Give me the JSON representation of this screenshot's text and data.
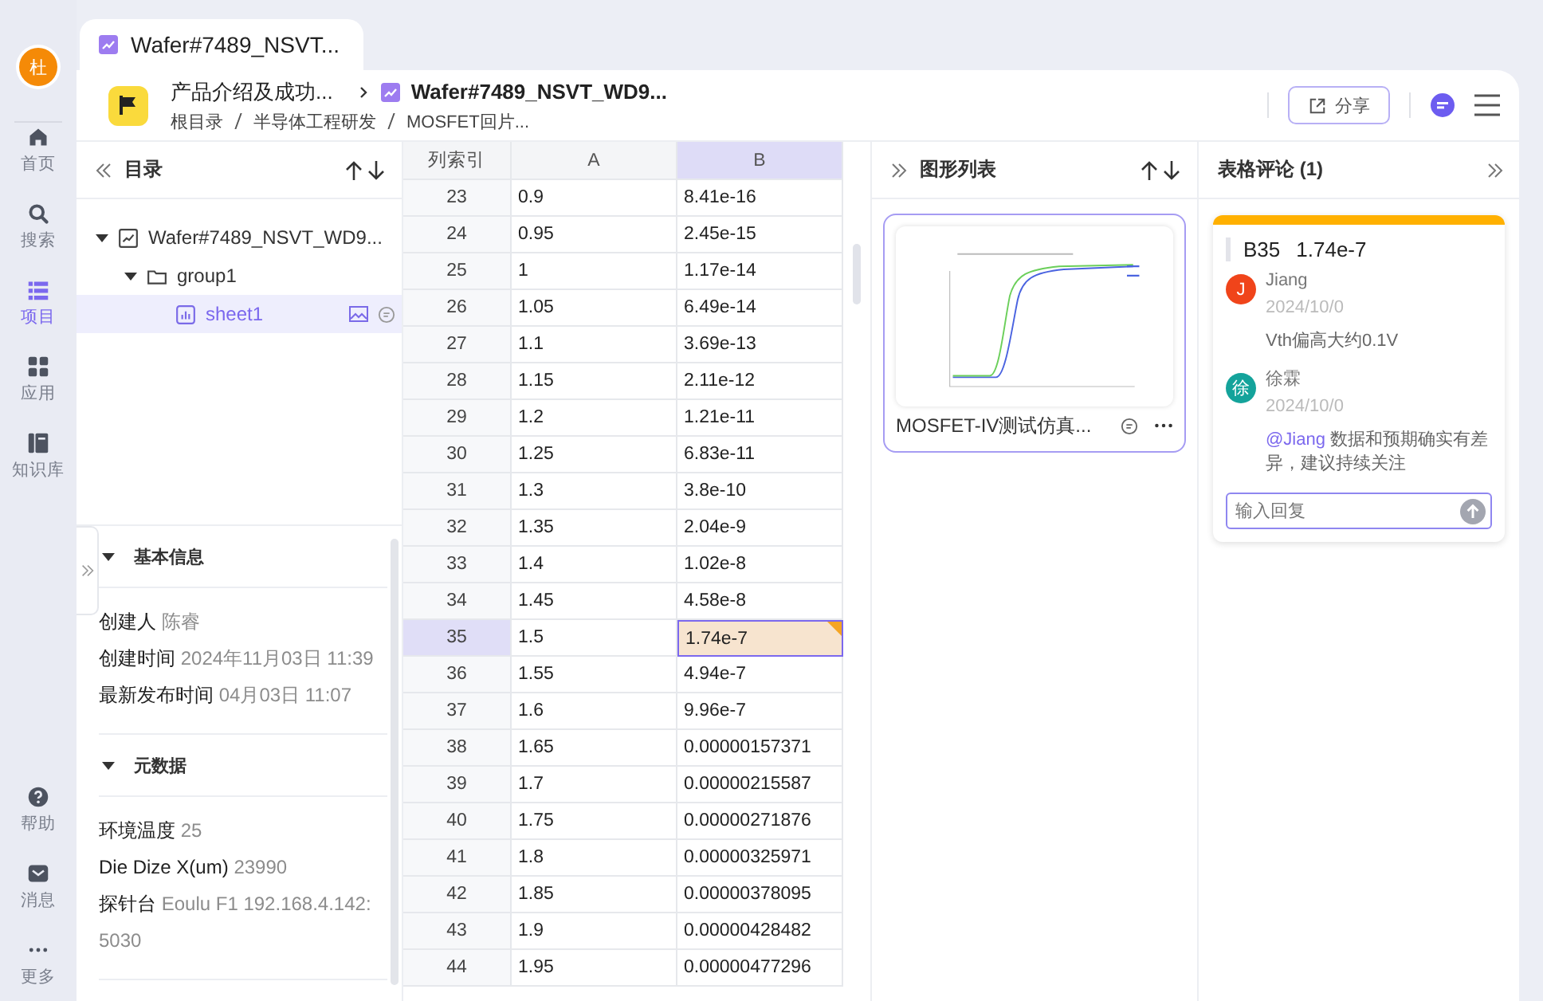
{
  "rail": {
    "avatar": "杜",
    "items": [
      {
        "label": "首页",
        "selected": false
      },
      {
        "label": "搜索",
        "selected": false
      },
      {
        "label": "项目",
        "selected": true
      },
      {
        "label": "应用",
        "selected": false
      },
      {
        "label": "知识库",
        "selected": false
      }
    ],
    "bottom_items": [
      {
        "label": "帮助",
        "selected": false
      },
      {
        "label": "消息",
        "selected": false
      },
      {
        "label": "更多",
        "selected": false
      }
    ]
  },
  "tab": {
    "title": "Wafer#7489_NSVT..."
  },
  "header": {
    "project": "产品介绍及成功...",
    "document": "Wafer#7489_NSVT_WD9...",
    "breadcrumb": [
      "根目录",
      "半导体工程研发",
      "MOSFET回片..."
    ],
    "share_button": "分享"
  },
  "tree": {
    "title": "目录",
    "items": [
      {
        "label": "Wafer#7489_NSVT_WD9...",
        "kind": "chart",
        "expanded": true,
        "selected": false,
        "children": [
          {
            "label": "group1",
            "kind": "folder",
            "expanded": true,
            "selected": false,
            "children": [
              {
                "label": "sheet1",
                "kind": "sheet",
                "selected": true
              }
            ]
          }
        ]
      }
    ]
  },
  "info": {
    "sections": [
      {
        "title": "基本信息",
        "expanded": true,
        "fields": [
          {
            "label": "创建人",
            "value": "陈睿"
          },
          {
            "label": "创建时间",
            "value": "2024年11月03日 11:39"
          },
          {
            "label": "最新发布时间",
            "value": "04月03日 11:07"
          }
        ]
      },
      {
        "title": "元数据",
        "expanded": true,
        "fields": [
          {
            "label": "环境温度",
            "value": "25"
          },
          {
            "label": "Die Dize X(um)",
            "value": "23990"
          },
          {
            "label": "探针台",
            "value": "Eoulu F1 192.168.4.142:5030"
          }
        ]
      }
    ]
  },
  "sheet": {
    "columns": [
      {
        "label": "列索引",
        "selected": false
      },
      {
        "label": "A",
        "selected": false
      },
      {
        "label": "B",
        "selected": true
      }
    ],
    "rows": [
      {
        "index": "23",
        "a": "0.9",
        "b": "8.41e-16",
        "selected": false,
        "commented": false
      },
      {
        "index": "24",
        "a": "0.95",
        "b": "2.45e-15",
        "selected": false,
        "commented": false
      },
      {
        "index": "25",
        "a": "1",
        "b": "1.17e-14",
        "selected": false,
        "commented": false
      },
      {
        "index": "26",
        "a": "1.05",
        "b": "6.49e-14",
        "selected": false,
        "commented": false
      },
      {
        "index": "27",
        "a": "1.1",
        "b": "3.69e-13",
        "selected": false,
        "commented": false
      },
      {
        "index": "28",
        "a": "1.15",
        "b": "2.11e-12",
        "selected": false,
        "commented": false
      },
      {
        "index": "29",
        "a": "1.2",
        "b": "1.21e-11",
        "selected": false,
        "commented": false
      },
      {
        "index": "30",
        "a": "1.25",
        "b": "6.83e-11",
        "selected": false,
        "commented": false
      },
      {
        "index": "31",
        "a": "1.3",
        "b": "3.8e-10",
        "selected": false,
        "commented": false
      },
      {
        "index": "32",
        "a": "1.35",
        "b": "2.04e-9",
        "selected": false,
        "commented": false
      },
      {
        "index": "33",
        "a": "1.4",
        "b": "1.02e-8",
        "selected": false,
        "commented": false
      },
      {
        "index": "34",
        "a": "1.45",
        "b": "4.58e-8",
        "selected": false,
        "commented": false
      },
      {
        "index": "35",
        "a": "1.5",
        "b": "1.74e-7",
        "selected": true,
        "commented": true
      },
      {
        "index": "36",
        "a": "1.55",
        "b": "4.94e-7",
        "selected": false,
        "commented": false
      },
      {
        "index": "37",
        "a": "1.6",
        "b": "9.96e-7",
        "selected": false,
        "commented": false
      },
      {
        "index": "38",
        "a": "1.65",
        "b": "0.00000157371",
        "selected": false,
        "commented": false
      },
      {
        "index": "39",
        "a": "1.7",
        "b": "0.00000215587",
        "selected": false,
        "commented": false
      },
      {
        "index": "40",
        "a": "1.75",
        "b": "0.00000271876",
        "selected": false,
        "commented": false
      },
      {
        "index": "41",
        "a": "1.8",
        "b": "0.00000325971",
        "selected": false,
        "commented": false
      },
      {
        "index": "42",
        "a": "1.85",
        "b": "0.00000378095",
        "selected": false,
        "commented": false
      },
      {
        "index": "43",
        "a": "1.9",
        "b": "0.00000428482",
        "selected": false,
        "commented": false
      },
      {
        "index": "44",
        "a": "1.95",
        "b": "0.00000477296",
        "selected": false,
        "commented": false
      }
    ]
  },
  "charts": {
    "title": "图形列表",
    "items": [
      {
        "title": "MOSFET-IV测试仿真...",
        "selected": true
      }
    ]
  },
  "comments": {
    "title": "表格评论 (1)",
    "threads": [
      {
        "cell": "B35",
        "value": "1.74e-7",
        "messages": [
          {
            "author": "Jiang",
            "avatar": "J",
            "color": "#f0441a",
            "date": "2024/10/0",
            "text": "Vth偏高大约0.1V"
          },
          {
            "author": "徐霖",
            "avatar": "徐",
            "color": "#14a39b",
            "date": "2024/10/0",
            "mention": "@Jiang",
            "text": "数据和预期确实有差异，建议持续关注"
          }
        ],
        "reply": {
          "placeholder": "输入回复"
        }
      }
    ]
  }
}
